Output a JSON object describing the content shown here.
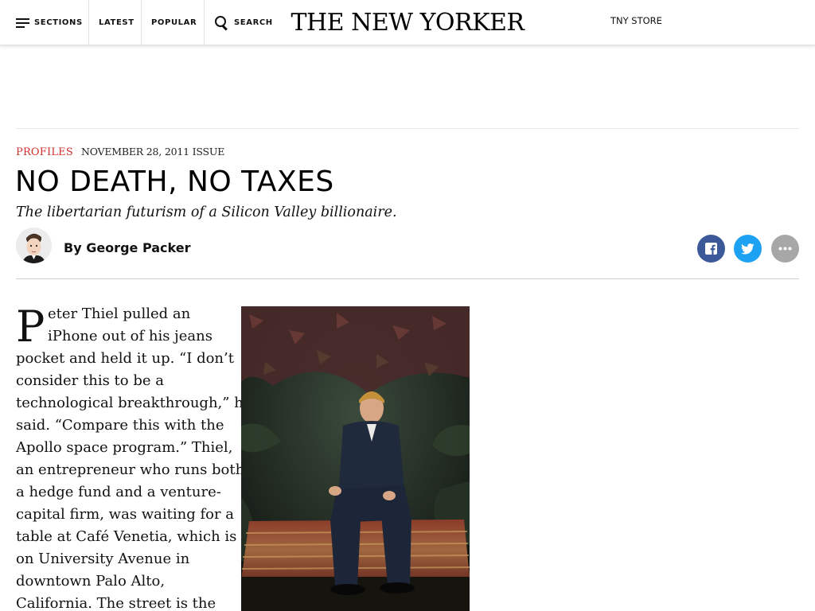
{
  "nav": {
    "sections_label": "SECTIONS",
    "latest_label": "LATEST",
    "popular_label": "POPULAR",
    "search_label": "SEARCH",
    "masthead": "THE NEW YORKER",
    "store_label": "TNY STORE"
  },
  "article": {
    "rubric": "PROFILES",
    "issue": "NOVEMBER 28, 2011 ISSUE",
    "headline": "NO DEATH, NO TAXES",
    "dek": "The libertarian futurism of a Silicon Valley billionaire.",
    "byline": "By George Packer",
    "share": {
      "facebook_icon": "facebook-icon",
      "twitter_icon": "twitter-icon",
      "more_icon": "more-options-icon",
      "colors": {
        "facebook": "#3b5998",
        "twitter": "#1da1f2",
        "more": "#a7a7a7"
      }
    },
    "body": {
      "drop_cap": "P",
      "lines": [
        "eter Thiel pulled an",
        "iPhone out of his jeans",
        "pocket and held it up. “I don’t",
        "consider this to be a",
        "technological breakthrough,” he",
        "said. “Compare this with the",
        "Apollo space program.” Thiel,",
        "an entrepreneur who runs both",
        "a hedge fund and a venture-",
        "capital firm, was waiting for a",
        "table at Café Venetia, which is",
        "on University Avenue in",
        "downtown Palo Alto,",
        "California. The street is the"
      ]
    }
  },
  "colors": {
    "rubric": "#d0302a",
    "text": "#111111",
    "divider": "#e2e2e2"
  }
}
